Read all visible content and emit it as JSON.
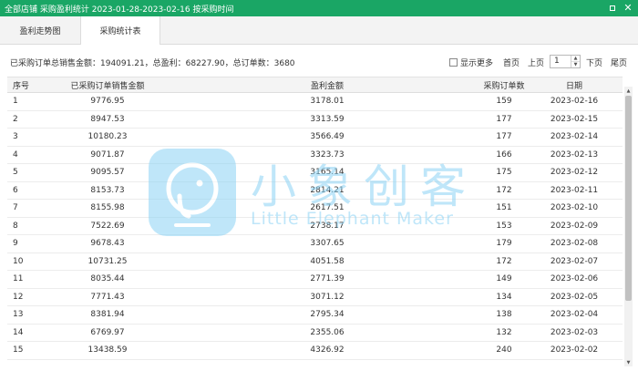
{
  "window": {
    "title": "全部店铺 采购盈利统计 2023-01-28-2023-02-16 按采购时间",
    "accent": "#1aa665"
  },
  "tabs": [
    {
      "label": "盈利走势图",
      "active": false
    },
    {
      "label": "采购统计表",
      "active": true
    }
  ],
  "summary": {
    "text": "已采购订单总销售金额：194091.21，总盈利：68227.90，总订单数：3680"
  },
  "options": {
    "show_more_label": "显示更多",
    "show_more_checked": false
  },
  "pager": {
    "first": "首页",
    "prev": "上页",
    "current": "1",
    "next": "下页",
    "last": "尾页"
  },
  "table": {
    "columns": [
      "序号",
      "已采购订单销售金额",
      "盈利金额",
      "采购订单数",
      "日期"
    ],
    "rows": [
      [
        "1",
        "9776.95",
        "3178.01",
        "159",
        "2023-02-16"
      ],
      [
        "2",
        "8947.53",
        "3313.59",
        "177",
        "2023-02-15"
      ],
      [
        "3",
        "10180.23",
        "3566.49",
        "177",
        "2023-02-14"
      ],
      [
        "4",
        "9071.87",
        "3323.73",
        "166",
        "2023-02-13"
      ],
      [
        "5",
        "9095.57",
        "3165.14",
        "175",
        "2023-02-12"
      ],
      [
        "6",
        "8153.73",
        "2814.21",
        "172",
        "2023-02-11"
      ],
      [
        "7",
        "8155.98",
        "2617.51",
        "151",
        "2023-02-10"
      ],
      [
        "8",
        "7522.69",
        "2738.17",
        "153",
        "2023-02-09"
      ],
      [
        "9",
        "9678.43",
        "3307.65",
        "179",
        "2023-02-08"
      ],
      [
        "10",
        "10731.25",
        "4051.58",
        "172",
        "2023-02-07"
      ],
      [
        "11",
        "8035.44",
        "2771.39",
        "149",
        "2023-02-06"
      ],
      [
        "12",
        "7771.43",
        "3071.12",
        "134",
        "2023-02-05"
      ],
      [
        "13",
        "8381.94",
        "2795.34",
        "138",
        "2023-02-04"
      ],
      [
        "14",
        "6769.97",
        "2355.06",
        "132",
        "2023-02-03"
      ],
      [
        "15",
        "13438.59",
        "4326.92",
        "240",
        "2023-02-02"
      ]
    ]
  },
  "watermark": {
    "brand": "小象创客",
    "brand_en": "Little Elephant Maker",
    "color": "#8bd3f5"
  }
}
